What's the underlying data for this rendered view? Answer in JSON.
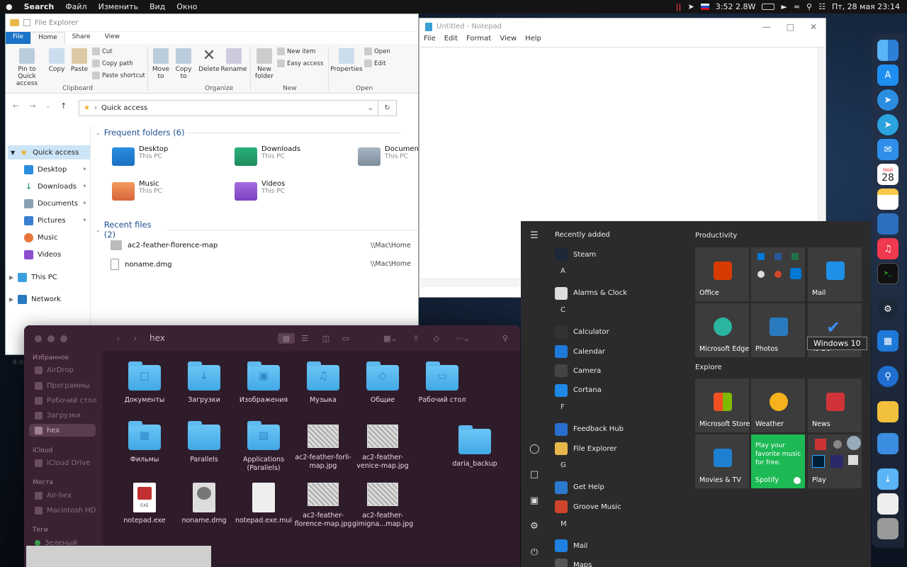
{
  "menubar": {
    "search": "Search",
    "menus": [
      "Файл",
      "Изменить",
      "Вид",
      "Окно"
    ],
    "status_text": "3:52 2.8W",
    "datetime": "Пт, 28 мая  23:14"
  },
  "file_explorer": {
    "title": "File Explorer",
    "tabs": [
      "File",
      "Home",
      "Share",
      "View"
    ],
    "ribbon": {
      "pin": "Pin to Quick access",
      "copy": "Copy",
      "paste": "Paste",
      "cut": "Cut",
      "copy_path": "Copy path",
      "paste_shortcut": "Paste shortcut",
      "clipboard": "Clipboard",
      "move_to": "Move to",
      "copy_to": "Copy to",
      "delete": "Delete",
      "rename": "Rename",
      "organize": "Organize",
      "new_folder": "New folder",
      "new_item": "New item",
      "easy_access": "Easy access",
      "new": "New",
      "properties": "Properties",
      "open_btn": "Open",
      "edit": "Edit",
      "open_group": "Open"
    },
    "address": "Quick access",
    "nav": [
      {
        "label": "Quick access"
      },
      {
        "label": "Desktop"
      },
      {
        "label": "Downloads"
      },
      {
        "label": "Documents"
      },
      {
        "label": "Pictures"
      },
      {
        "label": "Music"
      },
      {
        "label": "Videos"
      },
      {
        "label": "This PC"
      },
      {
        "label": "Network"
      }
    ],
    "frequent_title": "Frequent folders (6)",
    "folders": [
      {
        "name": "Desktop",
        "sub": "This PC"
      },
      {
        "name": "Downloads",
        "sub": "This PC"
      },
      {
        "name": "Documents",
        "sub": "This PC"
      },
      {
        "name": "Music",
        "sub": "This PC"
      },
      {
        "name": "Videos",
        "sub": "This PC"
      }
    ],
    "recent_title": "Recent files (2)",
    "recent": [
      {
        "name": "ac2-feather-florence-map",
        "path": "\\\\Mac\\Home"
      },
      {
        "name": "noname.dmg",
        "path": "\\\\Mac\\Home"
      }
    ],
    "status": "8 ite"
  },
  "notepad": {
    "title": "Untitled - Notepad",
    "menu": [
      "File",
      "Edit",
      "Format",
      "View",
      "Help"
    ]
  },
  "finder": {
    "title": "hex",
    "sidebar": {
      "favorites_header": "Избранное",
      "favorites": [
        "AirDrop",
        "Программы",
        "Рабочий стол",
        "Загрузки",
        "hex"
      ],
      "icloud_header": "iCloud",
      "icloud": [
        "iCloud Drive"
      ],
      "places_header": "Места",
      "places": [
        "Air-hex",
        "Macintosh HD"
      ],
      "tags_header": "Теги",
      "tags": [
        "Зеленый"
      ]
    },
    "items": [
      {
        "name": "Документы",
        "kind": "folder"
      },
      {
        "name": "Загрузки",
        "kind": "folder"
      },
      {
        "name": "Изображения",
        "kind": "folder"
      },
      {
        "name": "Музыка",
        "kind": "folder"
      },
      {
        "name": "Общие",
        "kind": "folder"
      },
      {
        "name": "Рабочий стол",
        "kind": "folder"
      },
      {
        "name": "Фильмы",
        "kind": "folder"
      },
      {
        "name": "Parallels",
        "kind": "folder"
      },
      {
        "name": "Applications (Parallels)",
        "kind": "folder"
      },
      {
        "name": "ac2-feather-forli-map.jpg",
        "kind": "image"
      },
      {
        "name": "ac2-feather-venice-map.jpg",
        "kind": "image"
      },
      {
        "name": "daria_backup",
        "kind": "folder"
      },
      {
        "name": "notepad.exe",
        "kind": "exe"
      },
      {
        "name": "noname.dmg",
        "kind": "dmg"
      },
      {
        "name": "notepad.exe.mui",
        "kind": "doc"
      },
      {
        "name": "ac2-feather-florence-map.jpg",
        "kind": "image"
      },
      {
        "name": "ac2-feather-gimigna...map.jpg",
        "kind": "image"
      }
    ]
  },
  "start_menu": {
    "recently_added": "Recently added",
    "apps": [
      {
        "label": "Steam"
      },
      {
        "letter": "A"
      },
      {
        "label": "Alarms & Clock"
      },
      {
        "letter": "C"
      },
      {
        "label": "Calculator"
      },
      {
        "label": "Calendar"
      },
      {
        "label": "Camera"
      },
      {
        "label": "Cortana"
      },
      {
        "letter": "F"
      },
      {
        "label": "Feedback Hub"
      },
      {
        "label": "File Explorer"
      },
      {
        "letter": "G"
      },
      {
        "label": "Get Help"
      },
      {
        "label": "Groove Music"
      },
      {
        "letter": "M"
      },
      {
        "label": "Mail"
      },
      {
        "label": "Maps"
      }
    ],
    "productivity": "Productivity",
    "explore": "Explore",
    "tiles": {
      "office": "Office",
      "mail": "Mail",
      "edge": "Microsoft Edge",
      "photos": "Photos",
      "todo": "To Do",
      "store": "Microsoft Store",
      "weather": "Weather",
      "news": "News",
      "movies": "Movies & TV",
      "spotify": "Spotify",
      "spotify_promo": "Play your favorite music for free.",
      "play": "Play"
    }
  },
  "tooltip": "Windows 10",
  "dock": {
    "calendar_month": "МАЙ",
    "calendar_day": "28"
  }
}
